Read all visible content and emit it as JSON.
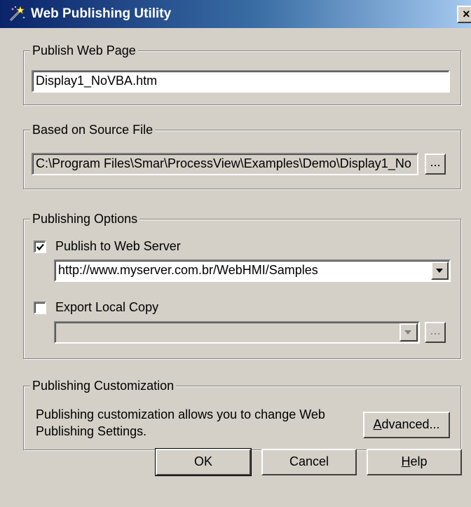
{
  "window": {
    "title": "Web Publishing Utility",
    "close_glyph": "×"
  },
  "publish_page": {
    "group_label": "Publish Web Page",
    "value": "Display1_NoVBA.htm"
  },
  "source_file": {
    "group_label": "Based on Source File",
    "value": "C:\\Program Files\\Smar\\ProcessView\\Examples\\Demo\\Display1_No",
    "browse_label": "..."
  },
  "options": {
    "group_label": "Publishing Options",
    "web_server": {
      "label": "Publish to Web Server",
      "checked": true,
      "url": "http://www.myserver.com.br/WebHMI/Samples"
    },
    "local_copy": {
      "label": "Export Local Copy",
      "checked": false,
      "path": "",
      "browse_label": "..."
    }
  },
  "customization": {
    "group_label": "Publishing Customization",
    "description_line1": "Publishing customization allows you  to change Web",
    "description_line2": "Publishing Settings.",
    "advanced_label_mnemonic": "A",
    "advanced_label_rest": "dvanced..."
  },
  "buttons": {
    "ok": "OK",
    "cancel": "Cancel",
    "help_mnemonic": "H",
    "help_rest": "elp"
  },
  "colors": {
    "dialog_bg": "#d4d0c8",
    "titlebar_start": "#0a246a",
    "titlebar_end": "#a6caf0"
  }
}
